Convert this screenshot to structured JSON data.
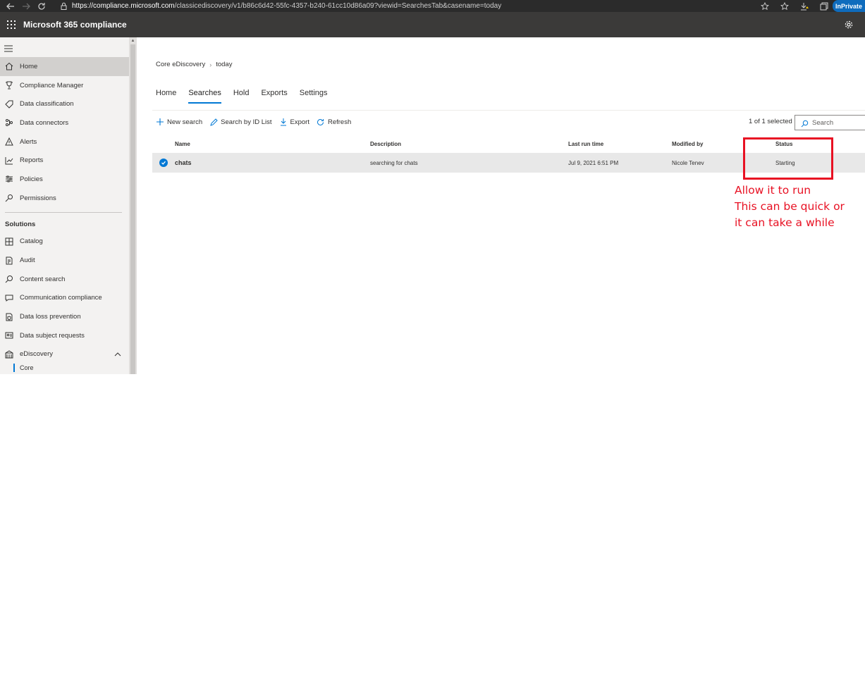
{
  "browser": {
    "url_host": "https://compliance.microsoft.com",
    "url_path": "/classicediscovery/v1/b86c6d42-55fc-4357-b240-61cc10d86a09?viewid=SearchesTab&casename=today",
    "inprivate_label": "InPrivate"
  },
  "app": {
    "title": "Microsoft 365 compliance"
  },
  "sidebar": {
    "items": [
      {
        "label": "Home",
        "icon": "home-icon"
      },
      {
        "label": "Compliance Manager",
        "icon": "trophy-icon"
      },
      {
        "label": "Data classification",
        "icon": "tag-icon"
      },
      {
        "label": "Data connectors",
        "icon": "connector-icon"
      },
      {
        "label": "Alerts",
        "icon": "warning-icon"
      },
      {
        "label": "Reports",
        "icon": "chart-icon"
      },
      {
        "label": "Policies",
        "icon": "sliders-icon"
      },
      {
        "label": "Permissions",
        "icon": "key-icon"
      }
    ],
    "section_title": "Solutions",
    "solutions": [
      {
        "label": "Catalog",
        "icon": "catalog-icon"
      },
      {
        "label": "Audit",
        "icon": "audit-icon"
      },
      {
        "label": "Content search",
        "icon": "search-icon"
      },
      {
        "label": "Communication compliance",
        "icon": "chat-icon"
      },
      {
        "label": "Data loss prevention",
        "icon": "shield-doc-icon"
      },
      {
        "label": "Data subject requests",
        "icon": "request-icon"
      },
      {
        "label": "eDiscovery",
        "icon": "ediscovery-icon"
      }
    ],
    "sub_item": "Core"
  },
  "breadcrumb": {
    "parent": "Core eDiscovery",
    "current": "today"
  },
  "tabs": [
    "Home",
    "Searches",
    "Hold",
    "Exports",
    "Settings"
  ],
  "toolbar": {
    "new_search": "New search",
    "search_by_id": "Search by ID List",
    "export": "Export",
    "refresh": "Refresh",
    "selected_count": "1 of 1 selected",
    "search_placeholder": "Search"
  },
  "table": {
    "headers": {
      "name": "Name",
      "description": "Description",
      "last_run": "Last run time",
      "modified_by": "Modified by",
      "status": "Status"
    },
    "rows": [
      {
        "name": "chats",
        "description": "searching for chats",
        "last_run": "Jul 9, 2021 6:51 PM",
        "modified_by": "Nicole Tenev",
        "status": "Starting"
      }
    ]
  },
  "annotation": {
    "color": "#e81123",
    "lines": [
      "Allow it to run",
      "This can be quick or",
      "it can take a while"
    ]
  },
  "colors": {
    "accent": "#0078d4",
    "header_bg": "#3b3a39",
    "sidebar_bg": "#f3f2f1"
  }
}
